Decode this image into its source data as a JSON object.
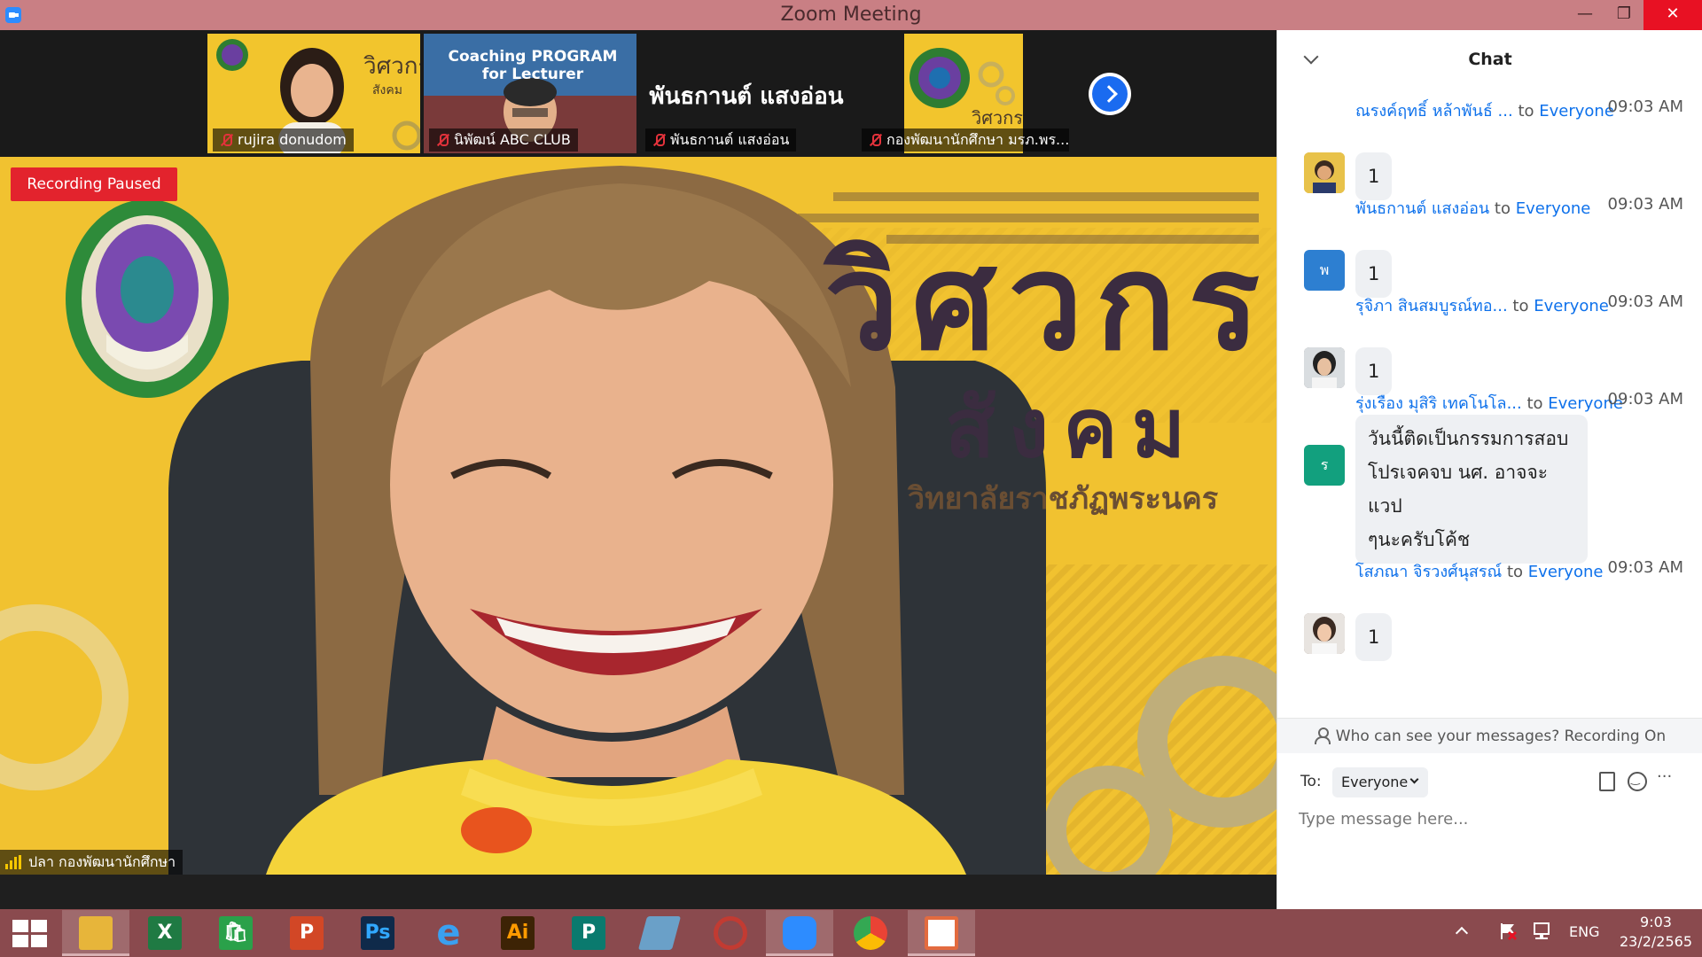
{
  "window": {
    "title": "Zoom Meeting",
    "controls": {
      "minimize": "—",
      "restore": "❐",
      "close": "✕"
    }
  },
  "thumbnails": [
    {
      "name": "rujira donudom",
      "bg": "#f2c52d"
    },
    {
      "name": "นิพัฒน์ ABC CLUB",
      "bg": "#2a5a8f",
      "banner_line1": "Coaching PROGRAM",
      "banner_line2": "for Lecturer"
    },
    {
      "name": "พันธกานต์ แสงอ่อน",
      "bg": "#1a1a1a",
      "display_name": "พันธกานต์ แสงอ่อน"
    },
    {
      "name": "กองพัฒนานักศึกษา มรภ.พร...",
      "bg": "#f2c52d"
    }
  ],
  "main_video": {
    "recording_status": "Recording Paused",
    "speaker_name": "ปลา กองพัฒนานักศึกษา",
    "background_title_line1": "วิศวกร",
    "background_title_line2": "สังคม",
    "background_subtitle": "วิทยาลัยราชภัฏพระนคร"
  },
  "chat": {
    "title": "Chat",
    "messages": [
      {
        "sender": "ณรงค์ฤทธิ์ หล้าพันธ์ ...",
        "to": "to",
        "recipient": "Everyone",
        "time": "09:03 AM",
        "text": "1",
        "avatar_text": "",
        "avatar_color": "#c9a13b"
      },
      {
        "sender": "พันธกานต์ แสงอ่อน",
        "to": "to",
        "recipient": "Everyone",
        "time": "09:03 AM",
        "text": "1",
        "avatar_text": "พ",
        "avatar_color": "#2d7fd1"
      },
      {
        "sender": "รุจิภา สินสมบูรณ์ทอ...",
        "to": "to",
        "recipient": "Everyone",
        "time": "09:03 AM",
        "text": "1",
        "avatar_text": "",
        "avatar_color": "#7b7b7b"
      },
      {
        "sender": "รุ่งเรือง มุสิริ เทคโนโล...",
        "to": "to",
        "recipient": "Everyone",
        "time": "09:03 AM",
        "text_lines": [
          "วันนี้ติดเป็นกรรมการสอบ",
          "โปรเจคจบ นศ. อาจจะแวป",
          "ๆนะครับโค้ช"
        ],
        "avatar_text": "ร",
        "avatar_color": "#12a07e"
      },
      {
        "sender": "โสภณา จิรวงศ์นุสรณ์",
        "to": "to",
        "recipient": "Everyone",
        "time": "09:03 AM",
        "text": "1",
        "avatar_text": "",
        "avatar_color": "#8a6f63"
      }
    ],
    "privacy_note": "Who can see your messages? Recording On",
    "to_label": "To:",
    "to_selected": "Everyone",
    "input_placeholder": "Type message here..."
  },
  "taskbar": {
    "apps": [
      {
        "name": "file-explorer",
        "label": "",
        "color": "#e7b53a"
      },
      {
        "name": "excel",
        "label": "X",
        "color": "#1f7a43"
      },
      {
        "name": "store",
        "label": "🛍",
        "color": "#2aa14a"
      },
      {
        "name": "powerpoint",
        "label": "P",
        "color": "#d24726"
      },
      {
        "name": "photoshop",
        "label": "Ps",
        "color": "#0f2a4a"
      },
      {
        "name": "internet-explorer",
        "label": "e",
        "color": "#1c8fe0"
      },
      {
        "name": "illustrator",
        "label": "Ai",
        "color": "#3d2305"
      },
      {
        "name": "publisher",
        "label": "P",
        "color": "#0a7a6e"
      },
      {
        "name": "notepad",
        "label": "",
        "color": "#6aa0c8"
      },
      {
        "name": "photoscape",
        "label": "",
        "color": "#c23b32"
      },
      {
        "name": "zoom",
        "label": "",
        "color": "#2d8cff"
      },
      {
        "name": "chrome",
        "label": "",
        "color": "#34a853"
      },
      {
        "name": "photo-viewer",
        "label": "",
        "color": "#e36b3f"
      }
    ],
    "tray": {
      "language": "ENG",
      "time": "9:03",
      "date": "23/2/2565"
    }
  }
}
